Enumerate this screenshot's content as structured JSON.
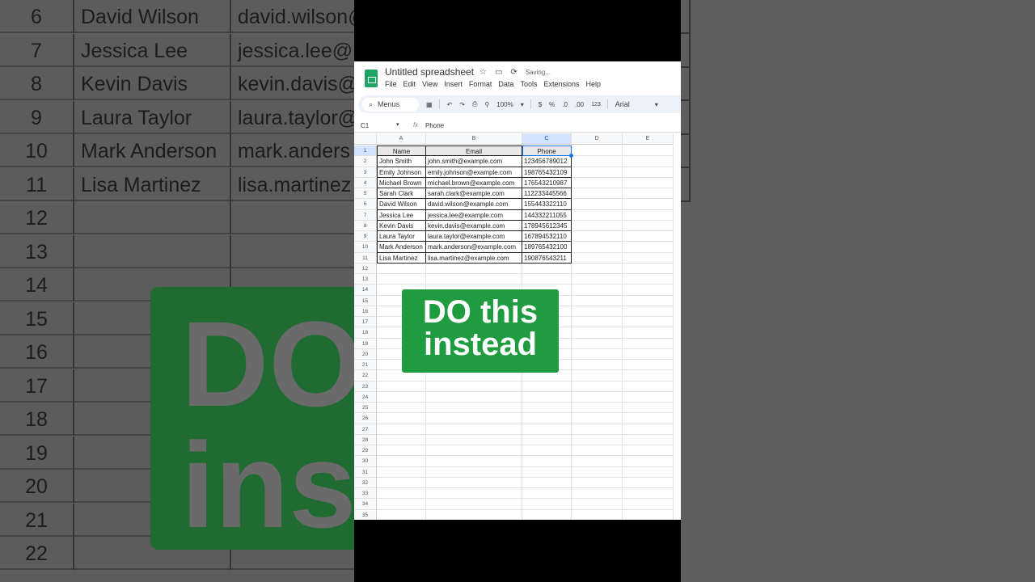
{
  "background": {
    "rows": [
      {
        "n": "6",
        "name": "David Wilson",
        "email": "david.wilson@"
      },
      {
        "n": "7",
        "name": "Jessica Lee",
        "email": "jessica.lee@"
      },
      {
        "n": "8",
        "name": "Kevin Davis",
        "email": "kevin.davis@"
      },
      {
        "n": "9",
        "name": "Laura Taylor",
        "email": "laura.taylor@"
      },
      {
        "n": "10",
        "name": "Mark Anderson",
        "email": "mark.anders"
      },
      {
        "n": "11",
        "name": "Lisa Martinez",
        "email": "lisa.martinez"
      },
      {
        "n": "12",
        "name": "",
        "email": ""
      },
      {
        "n": "13",
        "name": "",
        "email": ""
      },
      {
        "n": "14",
        "name": "",
        "email": ""
      },
      {
        "n": "15",
        "name": "",
        "email": ""
      },
      {
        "n": "16",
        "name": "",
        "email": ""
      },
      {
        "n": "17",
        "name": "",
        "email": ""
      },
      {
        "n": "18",
        "name": "",
        "email": ""
      },
      {
        "n": "19",
        "name": "",
        "email": ""
      },
      {
        "n": "20",
        "name": "",
        "email": ""
      },
      {
        "n": "21",
        "name": "",
        "email": ""
      },
      {
        "n": "22",
        "name": "",
        "email": ""
      }
    ],
    "overlay_line1": "DO",
    "overlay_line2": "ins"
  },
  "app": {
    "title": "Untitled spreadsheet",
    "status": "Saving..."
  },
  "menu": [
    "File",
    "Edit",
    "View",
    "Insert",
    "Format",
    "Data",
    "Tools",
    "Extensions",
    "Help"
  ],
  "toolbar": {
    "search": "Menus",
    "zoom": "100%",
    "currency": "$",
    "percent": "%",
    "dec_less": ".0",
    "dec_more": ".00",
    "number_format": "123",
    "font": "Arial"
  },
  "formula_bar": {
    "cell_ref": "C1",
    "fx": "fx",
    "value": "Phone"
  },
  "columns": [
    "A",
    "B",
    "C",
    "D",
    "E"
  ],
  "headers": [
    "Name",
    "Email",
    "Phone"
  ],
  "rows": [
    [
      "John Smith",
      "john.smith@example.com",
      "123456789012"
    ],
    [
      "Emily Johnson",
      "emily.johnson@example.com",
      "198765432109"
    ],
    [
      "Michael Brown",
      "michael.brown@example.com",
      "176543210987"
    ],
    [
      "Sarah Clark",
      "sarah.clark@example.com",
      "112233445566"
    ],
    [
      "David Wilson",
      "david.wilson@example.com",
      "155443322110"
    ],
    [
      "Jessica Lee",
      "jessica.lee@example.com",
      "144332211055"
    ],
    [
      "Kevin Davis",
      "kevin.davis@example.com",
      "178945612345"
    ],
    [
      "Laura Taylor",
      "laura.taylor@example.com",
      "167894532110"
    ],
    [
      "Mark Anderson",
      "mark.anderson@example.com",
      "189765432100"
    ],
    [
      "Lisa Martinez",
      "lisa.martinez@example.com",
      "190876543211"
    ]
  ],
  "row_count": 35,
  "overlay": {
    "line1": "DO this",
    "line2": "instead",
    "color": "#1e9c3f"
  }
}
